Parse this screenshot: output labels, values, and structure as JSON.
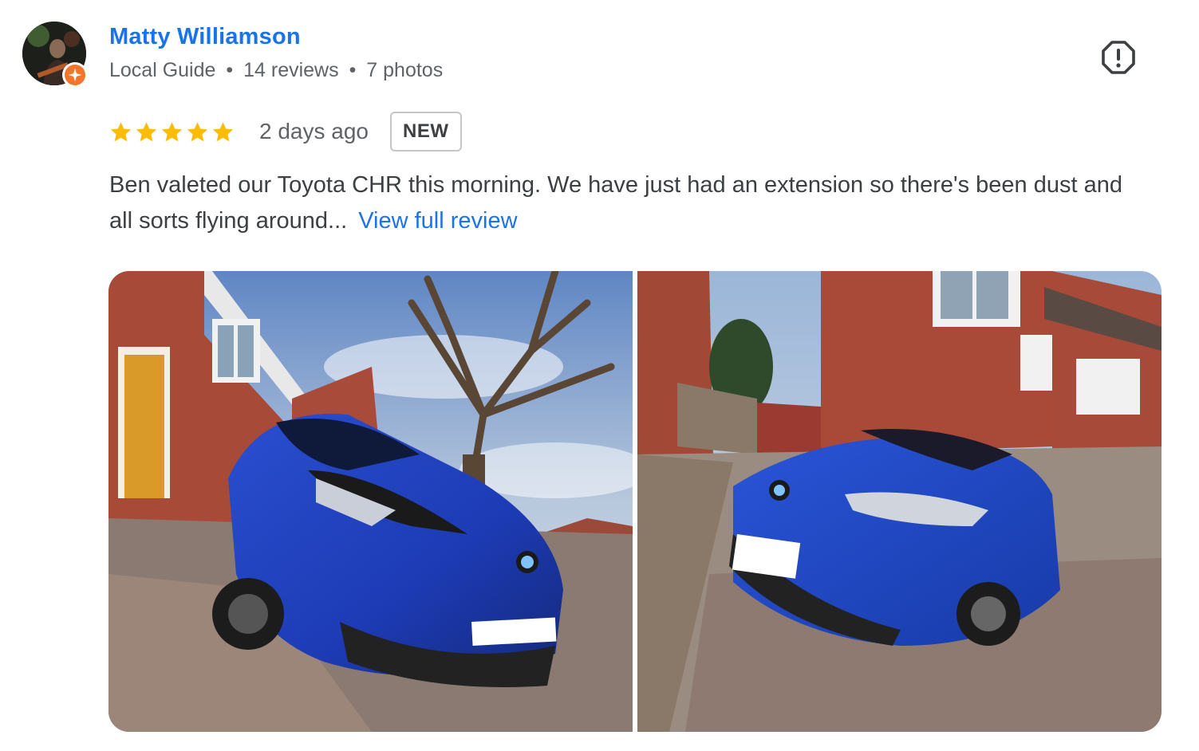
{
  "reviewer": {
    "name": "Matty Williamson",
    "guide_label": "Local Guide",
    "separator": "•",
    "reviews_count": "14 reviews",
    "photos_count": "7 photos"
  },
  "review": {
    "rating": 5,
    "stars": 5,
    "date": "2 days ago",
    "new_badge": "NEW",
    "text": "Ben valeted our Toyota CHR this morning. We have just had an extension so there's been dust and all sorts flying around...",
    "view_full_label": "View full review"
  },
  "photos": [
    {
      "subject": "blue Toyota C-HR front, brick house, bare tree"
    },
    {
      "subject": "blue Toyota C-HR on driveway, brick house"
    }
  ],
  "icons": {
    "report": "report-icon",
    "star": "star-icon",
    "local_guide_badge": "local-guide-badge-icon"
  },
  "colors": {
    "name_link": "#1a73e8",
    "star": "#fbbc04",
    "meta_text": "#5f6368",
    "badge_orange": "#f2752a"
  }
}
